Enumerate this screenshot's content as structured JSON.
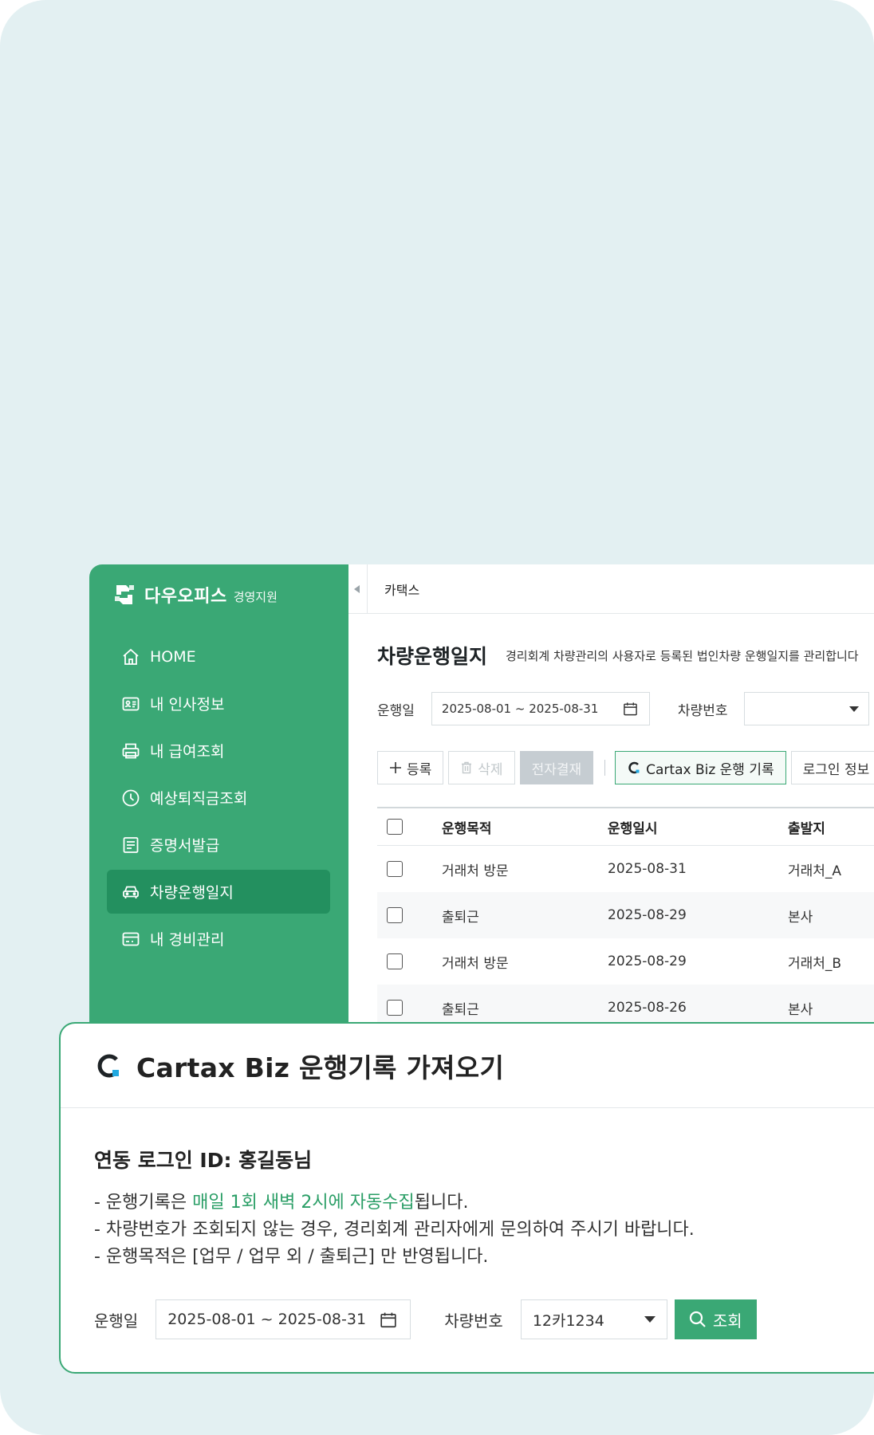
{
  "brand": {
    "name": "다우오피스",
    "sub": "경영지원"
  },
  "sidebar": {
    "items": [
      {
        "label": "HOME",
        "icon": "home-icon",
        "active": false
      },
      {
        "label": "내 인사정보",
        "icon": "id-card-icon",
        "active": false
      },
      {
        "label": "내 급여조회",
        "icon": "printer-icon",
        "active": false
      },
      {
        "label": "예상퇴직금조회",
        "icon": "clock-icon",
        "active": false
      },
      {
        "label": "증명서발급",
        "icon": "document-icon",
        "active": false
      },
      {
        "label": "차량운행일지",
        "icon": "car-icon",
        "active": true
      },
      {
        "label": "내 경비관리",
        "icon": "card-icon",
        "active": false
      }
    ]
  },
  "topbar": {
    "tab": "카택스"
  },
  "page": {
    "title": "차량운행일지",
    "description": "경리회계 차량관리의 사용자로 등록된 법인차량 운행일지를 관리합니다"
  },
  "filter": {
    "date_label": "운행일",
    "date_value": "2025-08-01 ~ 2025-08-31",
    "vehicle_label": "차량번호",
    "vehicle_value": ""
  },
  "buttons": {
    "register": "등록",
    "delete": "삭제",
    "approval": "전자결재",
    "cartax": "Cartax Biz 운행 기록",
    "login_info": "로그인 정보"
  },
  "table": {
    "headers": [
      "운행목적",
      "운행일시",
      "출발지"
    ],
    "rows": [
      [
        "거래처 방문",
        "2025-08-31",
        "거래처_A"
      ],
      [
        "출퇴근",
        "2025-08-29",
        "본사"
      ],
      [
        "거래처 방문",
        "2025-08-29",
        "거래처_B"
      ],
      [
        "출퇴근",
        "2025-08-26",
        "본사"
      ]
    ]
  },
  "modal": {
    "title": "Cartax Biz 운행기록 가져오기",
    "login_line": "연동 로그인 ID: 홍길동님",
    "notes": {
      "line1_pre": "- 운행기록은 ",
      "line1_highlight": "매일 1회 새벽 2시에 자동수집",
      "line1_post": "됩니다.",
      "line2": "- 차량번호가 조회되지 않는 경우, 경리회계 관리자에게 문의하여 주시기 바랍니다.",
      "line3": "- 운행목적은 [업무 / 업무 외 / 출퇴근] 만 반영됩니다."
    },
    "date_label": "운행일",
    "date_value": "2025-08-01 ~ 2025-08-31",
    "vehicle_label": "차량번호",
    "vehicle_value": "12카1234",
    "search_label": "조회"
  },
  "colors": {
    "brand_green": "#3aa875",
    "active_green": "#23905f",
    "background": "#e3f0f2",
    "highlight": "#2a9e66"
  }
}
